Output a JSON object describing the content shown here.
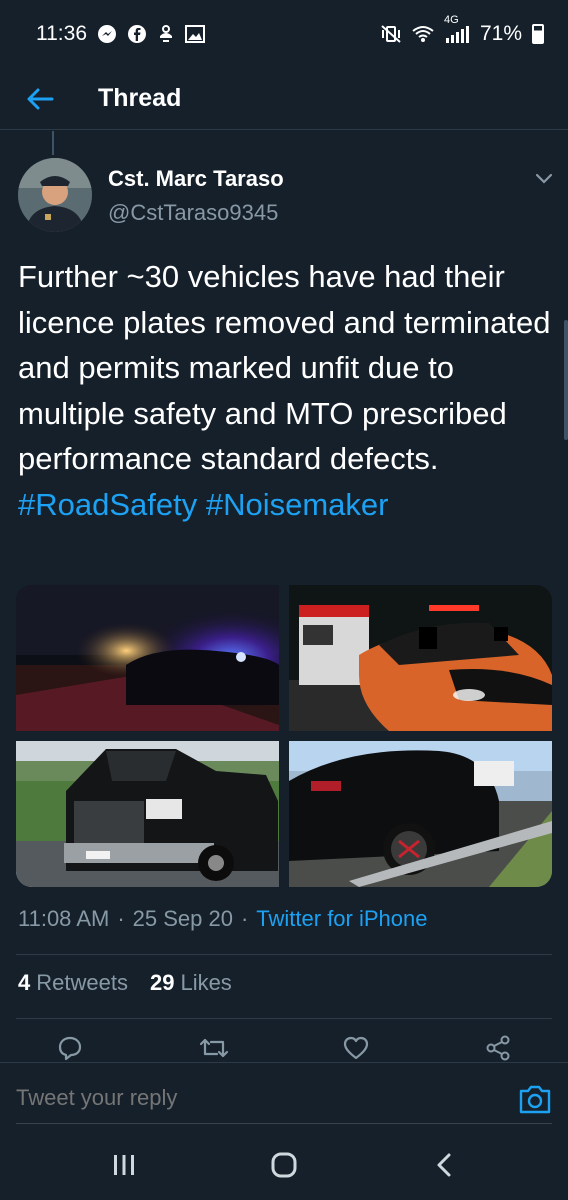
{
  "status_bar": {
    "time": "11:36",
    "left_icons": [
      "messenger-icon",
      "facebook-icon",
      "notification-icon",
      "gallery-icon"
    ],
    "network": "4G",
    "battery": "71%",
    "battery_level": 0.71
  },
  "header": {
    "back_icon": "arrow-left-icon",
    "title": "Thread"
  },
  "tweet": {
    "author_name": "Cst. Marc Taraso",
    "author_handle": "@CstTaraso9345",
    "text_main": "Further ~30 vehicles have had their licence plates removed and terminated and permits marked unfit due to multiple safety and MTO prescribed performance standard defects.",
    "hashtags": [
      "#RoadSafety",
      "#Noisemaker"
    ],
    "photos": [
      {
        "description_icon": "night-police-lights-photo"
      },
      {
        "description_icon": "tow-truck-car-photo"
      },
      {
        "description_icon": "pickup-truck-photo"
      },
      {
        "description_icon": "black-sedan-roadside-photo"
      }
    ],
    "time": "11:08 AM",
    "separator": "·",
    "date": "25 Sep 20",
    "source": "Twitter for iPhone",
    "retweets_count": "4",
    "retweets_label": "Retweets",
    "likes_count": "29",
    "likes_label": "Likes"
  },
  "actions": [
    "reply-icon",
    "retweet-icon",
    "like-icon",
    "share-icon"
  ],
  "reply": {
    "placeholder": "Tweet your reply"
  },
  "nav_bar": [
    "recent-apps-icon",
    "home-icon",
    "back-icon"
  ],
  "colors": {
    "background": "#15202b",
    "accent": "#1da1f2",
    "secondary_text": "#8899a6"
  }
}
